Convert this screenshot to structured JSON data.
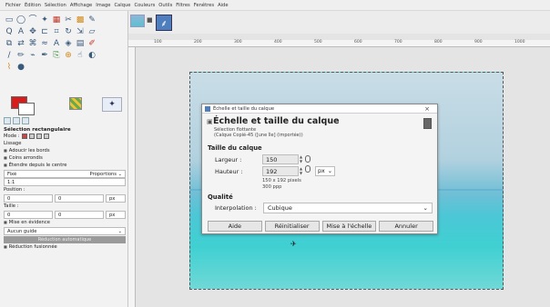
{
  "menubar": {
    "items": [
      "Fichier",
      "Édition",
      "Sélection",
      "Affichage",
      "Image",
      "Calque",
      "Couleurs",
      "Outils",
      "Filtres",
      "Fenêtres",
      "Aide"
    ]
  },
  "tool_options": {
    "title": "Sélection rectangulaire",
    "mode_label": "Mode :",
    "lissage": "Lissage",
    "adoucir": "Adoucir les bords",
    "coins": "Coins arrondis",
    "etendre": "Étendre depuis le centre",
    "fixe": "Fixé",
    "proportions": "Proportions",
    "ratio": "1:1",
    "position_label": "Position :",
    "unit_px": "px",
    "zero": "0",
    "taille_label": "Taille :",
    "mise_en_evidence": "Mise en évidence",
    "aucun_guide": "Aucun guide",
    "reduction_auto": "Réduction automatique",
    "reduction_fusionnee": "Réduction fusionnée"
  },
  "ruler": {
    "ticks": [
      "100",
      "200",
      "300",
      "400",
      "500",
      "600",
      "700",
      "800",
      "900",
      "1000"
    ]
  },
  "dialog": {
    "window_title": "Échelle et taille du calque",
    "header_title": "Échelle et taille du calque",
    "header_sub1": "Sélection flottante",
    "header_sub2": "(Calque Copié-45 ([une île] (importée))",
    "close_glyph": "×",
    "section_size": "Taille du calque",
    "width_label": "Largeur :",
    "width_value": "150",
    "height_label": "Hauteur :",
    "height_value": "192",
    "unit": "px",
    "size_info": "150 x 192 pixels",
    "resolution_info": "300 ppp",
    "section_quality": "Qualité",
    "interp_label": "Interpolation :",
    "interp_value": "Cubique",
    "buttons": {
      "help": "Aide",
      "reset": "Réinitialiser",
      "scale": "Mise à l'échelle",
      "cancel": "Annuler"
    }
  },
  "colors": {
    "foreground": "#d81b1b",
    "background": "#ffffff",
    "accent": "#4f7ebf"
  }
}
